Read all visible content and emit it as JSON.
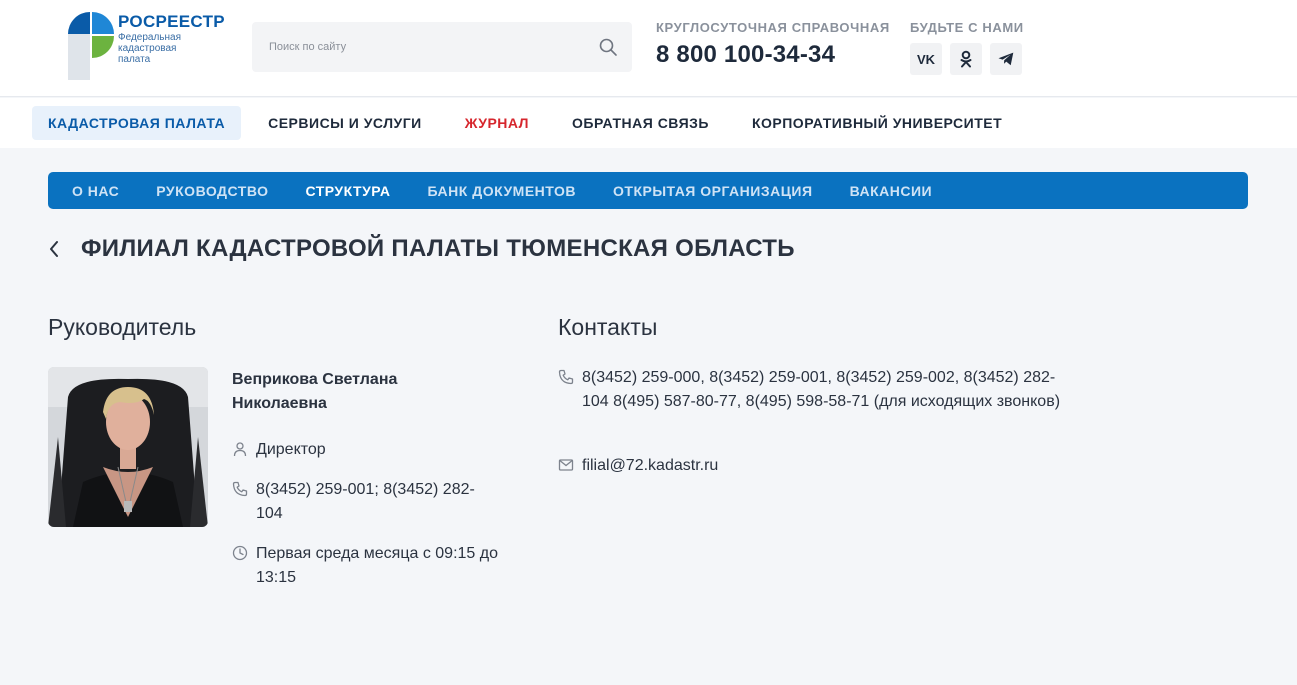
{
  "colors": {
    "brand_blue": "#0a5ba8",
    "nav_blue": "#0a72c0",
    "accent_red": "#d6262d",
    "text": "#2b3340"
  },
  "logo": {
    "title": "РОСРЕЕСТР",
    "subtitle": "Федеральная кадастровая палата"
  },
  "search": {
    "placeholder": "Поиск по сайту",
    "value": "",
    "icon": "search-icon"
  },
  "hotline": {
    "label": "КРУГЛОСУТОЧНАЯ СПРАВОЧНАЯ",
    "phone": "8 800 100-34-34"
  },
  "social": {
    "label": "БУДЬТЕ С НАМИ",
    "items": [
      {
        "icon": "vk-icon",
        "glyph": "VK"
      },
      {
        "icon": "odnoklassniki-icon",
        "glyph": ""
      },
      {
        "icon": "telegram-icon",
        "glyph": ""
      }
    ]
  },
  "main_nav": {
    "items": [
      {
        "label": "КАДАСТРОВАЯ ПАЛАТА",
        "state": "active"
      },
      {
        "label": "СЕРВИСЫ И УСЛУГИ",
        "state": ""
      },
      {
        "label": "ЖУРНАЛ",
        "state": "red"
      },
      {
        "label": "ОБРАТНАЯ СВЯЗЬ",
        "state": ""
      },
      {
        "label": "КОРПОРАТИВНЫЙ УНИВЕРСИТЕТ",
        "state": ""
      }
    ]
  },
  "sub_nav": {
    "items": [
      {
        "label": "О НАС",
        "active": false
      },
      {
        "label": "РУКОВОДСТВО",
        "active": false
      },
      {
        "label": "СТРУКТУРА",
        "active": true
      },
      {
        "label": "БАНК ДОКУМЕНТОВ",
        "active": false
      },
      {
        "label": "ОТКРЫТАЯ ОРГАНИЗАЦИЯ",
        "active": false
      },
      {
        "label": "ВАКАНСИИ",
        "active": false
      }
    ]
  },
  "page": {
    "title": "ФИЛИАЛ КАДАСТРОВОЙ ПАЛАТЫ ТЮМЕНСКАЯ ОБЛАСТЬ"
  },
  "leader": {
    "section_title": "Руководитель",
    "name": "Веприкова Светлана Николаевна",
    "position": "Директор",
    "phone": "8(3452) 259-001; 8(3452) 282-104",
    "hours": "Первая среда месяца с 09:15 до 13:15"
  },
  "contacts": {
    "section_title": "Контакты",
    "phone": "8(3452) 259-000, 8(3452) 259-001, 8(3452) 259-002, 8(3452) 282-104 8(495) 587-80-77, 8(495) 598-58-71 (для исходящих звонков)",
    "email": "filial@72.kadastr.ru"
  }
}
